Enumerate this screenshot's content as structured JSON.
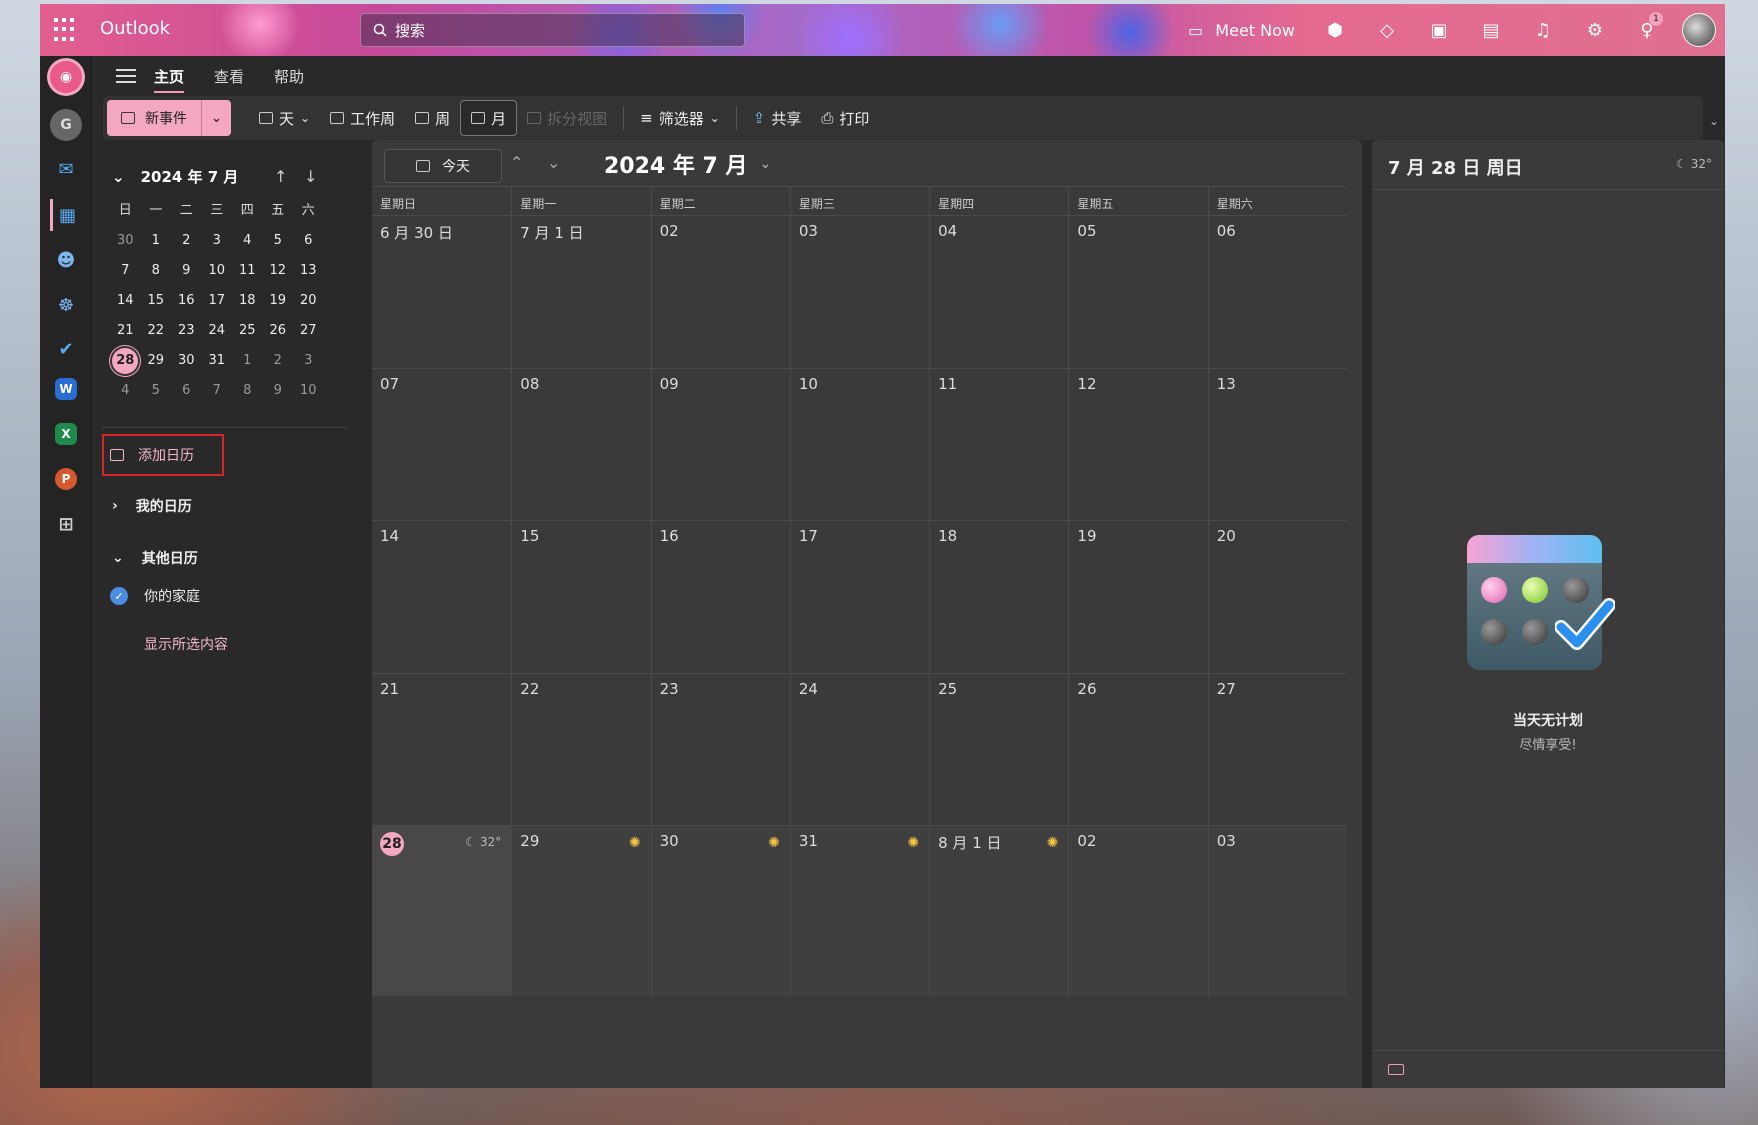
{
  "topbar": {
    "app_name": "Outlook",
    "search_placeholder": "搜索",
    "meet_now": "Meet Now",
    "notif_badge": "1"
  },
  "menu": {
    "items": [
      "主页",
      "查看",
      "帮助"
    ]
  },
  "ribbon": {
    "new_event": "新事件",
    "day": "天",
    "work_week": "工作周",
    "week": "周",
    "month": "月",
    "split_view": "拆分视图",
    "filter": "筛选器",
    "share": "共享",
    "print": "打印"
  },
  "mini_cal": {
    "title": "2024 年 7 月",
    "weekdays": [
      "日",
      "一",
      "二",
      "三",
      "四",
      "五",
      "六"
    ],
    "weeks": [
      [
        "30",
        "1",
        "2",
        "3",
        "4",
        "5",
        "6"
      ],
      [
        "7",
        "8",
        "9",
        "10",
        "11",
        "12",
        "13"
      ],
      [
        "14",
        "15",
        "16",
        "17",
        "18",
        "19",
        "20"
      ],
      [
        "21",
        "22",
        "23",
        "24",
        "25",
        "26",
        "27"
      ],
      [
        "28",
        "29",
        "30",
        "31",
        "1",
        "2",
        "3"
      ],
      [
        "4",
        "5",
        "6",
        "7",
        "8",
        "9",
        "10"
      ]
    ]
  },
  "left_nav": {
    "add_calendar": "添加日历",
    "my_calendars": "我的日历",
    "other_calendars": "其他日历",
    "family": "你的家庭",
    "show_selected": "显示所选内容"
  },
  "calendar": {
    "today_button": "今天",
    "title": "2024 年 7 月",
    "weekdays": [
      "星期日",
      "星期一",
      "星期二",
      "星期三",
      "星期四",
      "星期五",
      "星期六"
    ],
    "weeks": [
      [
        "6 月 30 日",
        "7 月 1 日",
        "02",
        "03",
        "04",
        "05",
        "06"
      ],
      [
        "07",
        "08",
        "09",
        "10",
        "11",
        "12",
        "13"
      ],
      [
        "14",
        "15",
        "16",
        "17",
        "18",
        "19",
        "20"
      ],
      [
        "21",
        "22",
        "23",
        "24",
        "25",
        "26",
        "27"
      ],
      [
        "28",
        "29",
        "30",
        "31",
        "8 月 1 日",
        "02",
        "03"
      ]
    ],
    "weather": {
      "temp": "32°"
    }
  },
  "agenda": {
    "title": "7 月 28 日 周日",
    "temp": "32°",
    "empty_title": "当天无计划",
    "empty_sub": "尽情享受!"
  }
}
